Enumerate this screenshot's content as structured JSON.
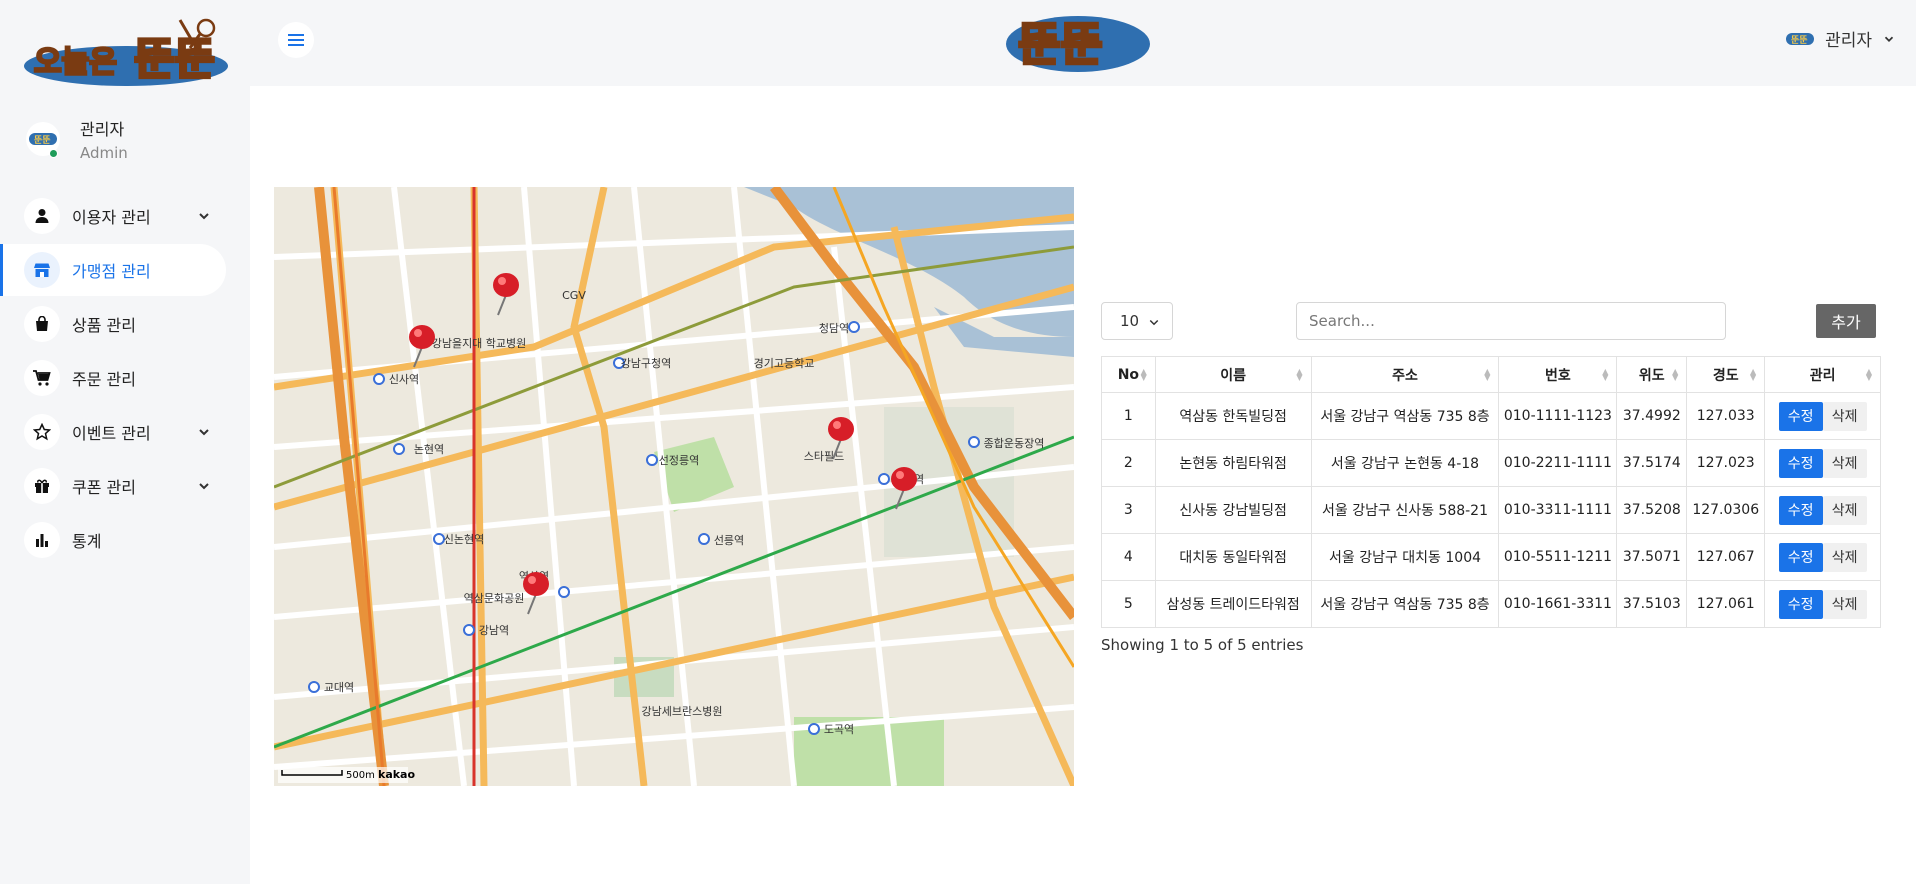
{
  "brand": {
    "logo_text": "오늘은 뚠뚠",
    "header_logo_text": "뚠뚠",
    "accent": "#1a73e8"
  },
  "profile": {
    "name": "관리자",
    "role": "Admin",
    "status_color": "#1e9c5a"
  },
  "sidebar": {
    "items": [
      {
        "label": "이용자 관리",
        "icon": "person-icon",
        "has_children": true
      },
      {
        "label": "가맹점 관리",
        "icon": "store-icon",
        "active": true
      },
      {
        "label": "상품 관리",
        "icon": "bag-icon"
      },
      {
        "label": "주문 관리",
        "icon": "cart-icon"
      },
      {
        "label": "이벤트 관리",
        "icon": "star-icon",
        "has_children": true
      },
      {
        "label": "쿠폰 관리",
        "icon": "gift-icon",
        "has_children": true
      },
      {
        "label": "통계",
        "icon": "bar-chart-icon"
      }
    ]
  },
  "header": {
    "user_label": "관리자"
  },
  "map": {
    "scale_label": "500m",
    "provider": "kakao",
    "labels": [
      "신사역",
      "논현역",
      "신논현역",
      "강남역",
      "역삼역",
      "선릉역",
      "선정릉역",
      "삼성역",
      "청담역",
      "강남구청역",
      "교대역",
      "도곡역",
      "종합운동장역",
      "CGV",
      "강남을지대 학교병원",
      "역삼문화공원",
      "경기고등학교",
      "강남세브란스병원",
      "스타필드"
    ],
    "pins": 5
  },
  "table": {
    "page_length": "10",
    "search_placeholder": "Search...",
    "add_label": "추가",
    "columns": [
      "No",
      "이름",
      "주소",
      "번호",
      "위도",
      "경도",
      "관리"
    ],
    "rows": [
      {
        "no": "1",
        "name": "역삼동 한독빌딩점",
        "address": "서울 강남구 역삼동 735 8층",
        "phone": "010-1111-1123",
        "lat": "37.4992",
        "lng": "127.033"
      },
      {
        "no": "2",
        "name": "논현동 하림타워점",
        "address": "서울 강남구 논현동 4-18",
        "phone": "010-2211-1111",
        "lat": "37.5174",
        "lng": "127.023"
      },
      {
        "no": "3",
        "name": "신사동 강남빌딩점",
        "address": "서울 강남구 신사동 588-21",
        "phone": "010-3311-1111",
        "lat": "37.5208",
        "lng": "127.0306"
      },
      {
        "no": "4",
        "name": "대치동 동일타워점",
        "address": "서울 강남구 대치동 1004",
        "phone": "010-5511-1211",
        "lat": "37.5071",
        "lng": "127.067"
      },
      {
        "no": "5",
        "name": "삼성동 트레이드타워점",
        "address": "서울 강남구 역삼동 735 8층",
        "phone": "010-1661-3311",
        "lat": "37.5103",
        "lng": "127.061"
      }
    ],
    "edit_label": "수정",
    "delete_label": "삭제",
    "info": "Showing 1 to 5 of 5 entries"
  }
}
